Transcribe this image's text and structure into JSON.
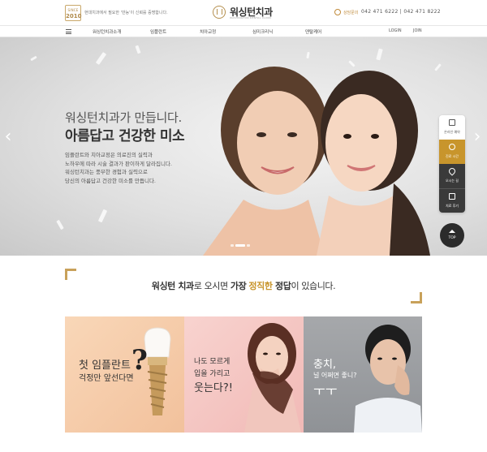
{
  "topbar": {
    "since_label": "SINCE",
    "since_year": "2010",
    "tagline": "현대치과에서 필요한 '만능'이 신뢰를 증명합니다.",
    "logo_text": "워싱턴치과",
    "logo_sub": "WASHINGTON DENTAL CLINIC",
    "phone_label": "상담문의",
    "phone_numbers": "042 471 6222  |  042 471 8222"
  },
  "nav": {
    "items": [
      "워싱턴치과소개",
      "임플란트",
      "치아교정",
      "심미크리닉",
      "덴탈케어"
    ],
    "login": "LOGIN",
    "join": "JOIN"
  },
  "hero": {
    "headline_1": "워싱턴치과가 만듭니다.",
    "headline_2": "아름답고 건강한 미소",
    "body_lines": [
      "임플란트와 치아교정은 의료진의 실력과",
      "노하우에 따라 시술 결과가 판이하게 달라집니다.",
      "워싱턴치과는 풍부한 경험과 실력으로",
      "당신의 아름답고 건강한 미소를 만듭니다."
    ],
    "slides_total": 3,
    "slide_active": 1
  },
  "quick_menu": {
    "items": [
      "온라인 예약",
      "진료 시간",
      "오시는 길",
      "치료 후기"
    ],
    "top": "TOP"
  },
  "intro": {
    "part_1": "워싱턴 치과",
    "part_2": "로 오시면 ",
    "part_3": "가장",
    "part_4": " ",
    "part_5": "정직한",
    "part_6": " 정답",
    "part_7": "이 있습니다."
  },
  "cards": {
    "implant_line_1": "첫 임플란트",
    "implant_line_2": "걱정만 앞선다면",
    "smile_line_1": "나도 모르게",
    "smile_line_2": "입을 가리고",
    "smile_line_3": "웃는다?!",
    "cavity_line_1": "충치,",
    "cavity_line_2": "널 어쩌면 좋니?",
    "cavity_line_3": "ㅜㅜ"
  },
  "colors": {
    "gold": "#c8952c",
    "dark": "#2b2b2b"
  }
}
